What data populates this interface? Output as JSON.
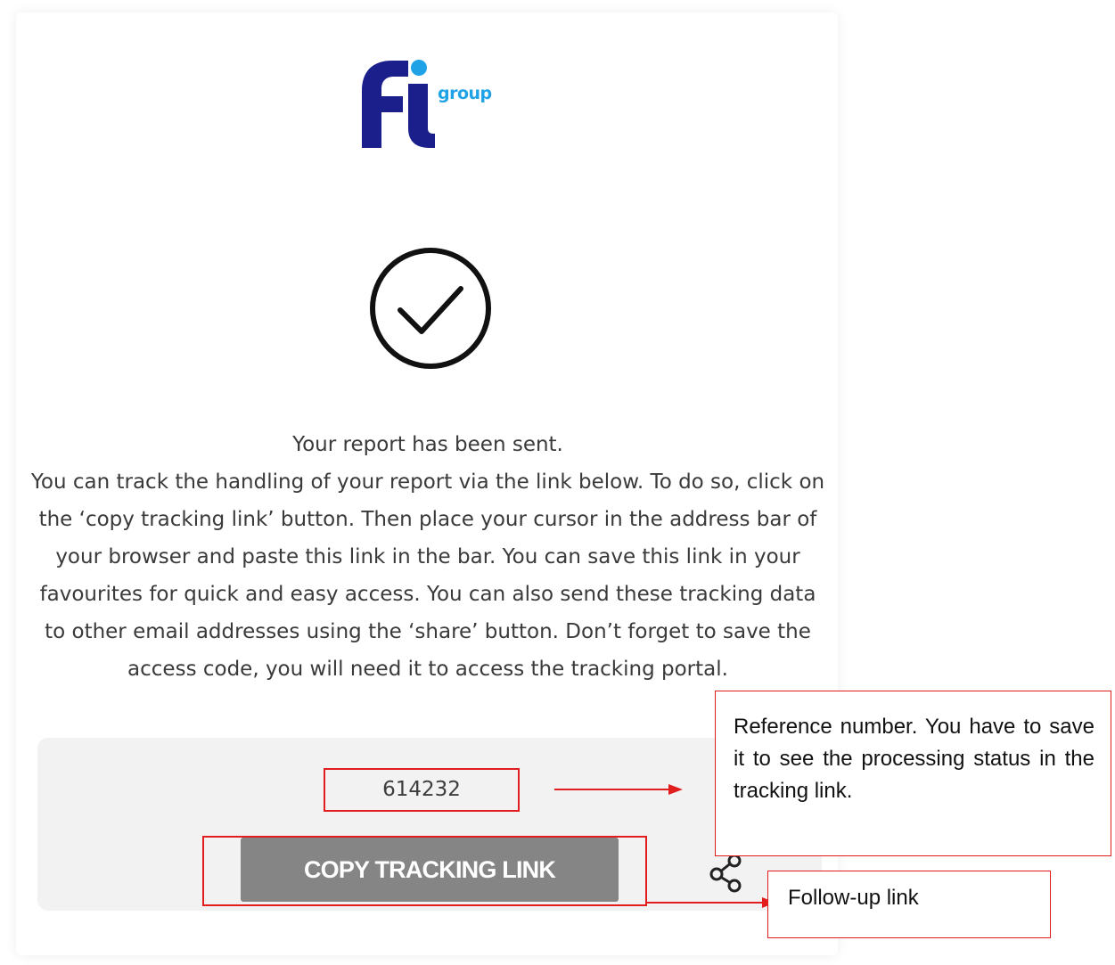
{
  "logo": {
    "brand_text": "fi",
    "group_text": "group",
    "colors": {
      "navy": "#1a1f8c",
      "sky": "#1fa3e6"
    }
  },
  "status_icon": "check-circle-icon",
  "message": {
    "line1": "Your report has been sent.",
    "body": "You can track the handling of your report via the link below. To do so, click on the ‘copy tracking link’ button. Then place your cursor in the address bar of your browser and paste this link in the bar. You can save this link in your favourites for quick and easy access. You can also send these tracking data to other email addresses using the ‘share’ button. Don’t forget to save the access code, you will need it to access the tracking portal."
  },
  "reference": {
    "number": "614232"
  },
  "actions": {
    "copy_label": "COPY TRACKING LINK",
    "share_icon": "share-icon"
  },
  "annotations": {
    "reference_note": "Reference number. You have to save it to see the processing status in the tracking link.",
    "followup_note": "Follow-up link",
    "color": "#e21d1d"
  }
}
